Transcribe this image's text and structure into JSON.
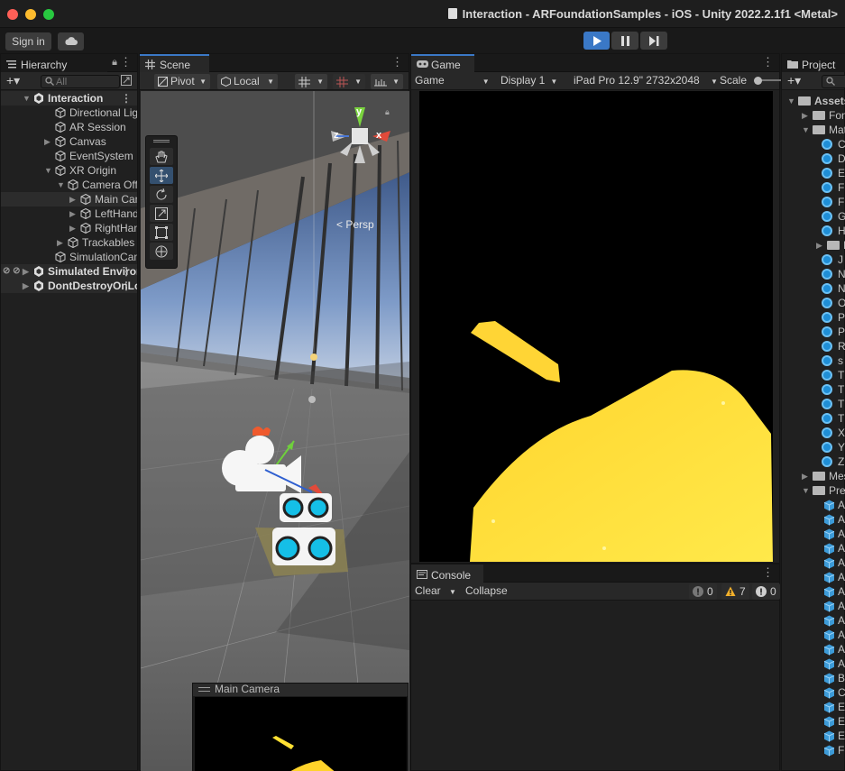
{
  "window": {
    "title": "Interaction - ARFoundationSamples - iOS - Unity 2022.2.1f1 <Metal>"
  },
  "toolbar": {
    "sign_in": "Sign in"
  },
  "hierarchy": {
    "tab": "Hierarchy",
    "search_placeholder": "All",
    "items": [
      {
        "label": "Interaction",
        "kind": "scene"
      },
      {
        "label": "Directional Light"
      },
      {
        "label": "AR Session"
      },
      {
        "label": "Canvas"
      },
      {
        "label": "EventSystem"
      },
      {
        "label": "XR Origin"
      },
      {
        "label": "Camera Offset"
      },
      {
        "label": "Main Camera"
      },
      {
        "label": "LeftHand"
      },
      {
        "label": "RightHand"
      },
      {
        "label": "Trackables"
      },
      {
        "label": "SimulationCamera"
      },
      {
        "label": "Simulated Environment Scene",
        "kind": "scene"
      },
      {
        "label": "DontDestroyOnLoad",
        "kind": "scene"
      }
    ]
  },
  "scene": {
    "tab": "Scene",
    "pivot": "Pivot",
    "local": "Local",
    "persp": "Persp",
    "gizmo": {
      "y": "y",
      "x": "x",
      "z": "z"
    },
    "camera_preview_title": "Main Camera"
  },
  "game": {
    "tab": "Game",
    "mode": "Game",
    "display": "Display 1",
    "resolution": "iPad Pro 12.9\" 2732x2048",
    "scale_label": "Scale"
  },
  "console": {
    "tab": "Console",
    "clear": "Clear",
    "collapse": "Collapse",
    "info_count": "0",
    "warning_count": "7",
    "error_count": "0"
  },
  "project": {
    "tab": "Project",
    "items": [
      {
        "label": "Assets",
        "kind": "folder"
      },
      {
        "label": "Fonts",
        "kind": "folder"
      },
      {
        "label": "Materials",
        "kind": "folder"
      },
      {
        "label": "C",
        "kind": "material"
      },
      {
        "label": "D",
        "kind": "material"
      },
      {
        "label": "E",
        "kind": "material"
      },
      {
        "label": "F",
        "kind": "material"
      },
      {
        "label": "F",
        "kind": "material"
      },
      {
        "label": "G",
        "kind": "material"
      },
      {
        "label": "H",
        "kind": "material"
      },
      {
        "label": "Is",
        "kind": "folder"
      },
      {
        "label": "J",
        "kind": "material"
      },
      {
        "label": "N",
        "kind": "material"
      },
      {
        "label": "N",
        "kind": "material"
      },
      {
        "label": "O",
        "kind": "material"
      },
      {
        "label": "P",
        "kind": "material"
      },
      {
        "label": "P",
        "kind": "material"
      },
      {
        "label": "R",
        "kind": "material"
      },
      {
        "label": "s",
        "kind": "material"
      },
      {
        "label": "T",
        "kind": "material"
      },
      {
        "label": "T",
        "kind": "material"
      },
      {
        "label": "T",
        "kind": "material"
      },
      {
        "label": "T",
        "kind": "material"
      },
      {
        "label": "X",
        "kind": "material"
      },
      {
        "label": "Y",
        "kind": "material"
      },
      {
        "label": "Z",
        "kind": "material"
      },
      {
        "label": "Meshes",
        "kind": "folder"
      },
      {
        "label": "Prefabs",
        "kind": "folder"
      },
      {
        "label": "A",
        "kind": "prefab"
      },
      {
        "label": "A",
        "kind": "prefab"
      },
      {
        "label": "A",
        "kind": "prefab"
      },
      {
        "label": "A",
        "kind": "prefab"
      },
      {
        "label": "A",
        "kind": "prefab"
      },
      {
        "label": "A",
        "kind": "prefab"
      },
      {
        "label": "A",
        "kind": "prefab"
      },
      {
        "label": "A",
        "kind": "prefab"
      },
      {
        "label": "A",
        "kind": "prefab"
      },
      {
        "label": "A",
        "kind": "prefab"
      },
      {
        "label": "A",
        "kind": "prefab"
      },
      {
        "label": "A",
        "kind": "prefab"
      },
      {
        "label": "B",
        "kind": "prefab"
      },
      {
        "label": "C",
        "kind": "prefab"
      },
      {
        "label": "E",
        "kind": "prefab"
      },
      {
        "label": "E",
        "kind": "prefab"
      },
      {
        "label": "E",
        "kind": "prefab"
      },
      {
        "label": "F",
        "kind": "prefab"
      }
    ]
  }
}
